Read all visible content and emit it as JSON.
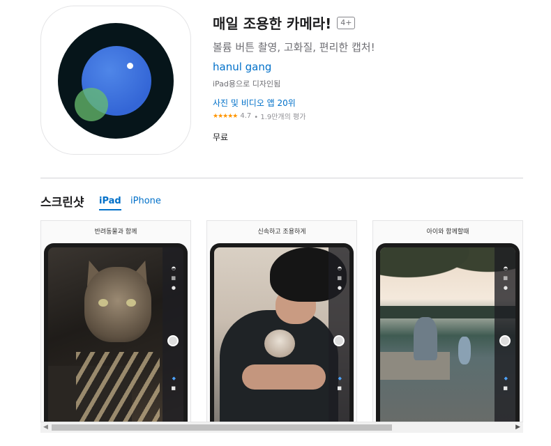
{
  "app": {
    "title": "매일 조용한 카메라!",
    "age_rating": "4+",
    "subtitle": "볼륨 버튼 촬영, 고화질, 편리한 캡처!",
    "developer": "hanul gang",
    "designed_for": "iPad용으로 디자인됨",
    "rank": "사진 및 비디오 앱 20위",
    "rating_value": "4.7",
    "rating_count": "• 1.9만개의 평가",
    "stars": "★★★★★",
    "price": "무료"
  },
  "screenshots_section": {
    "title": "스크린샷",
    "tabs": [
      "iPad",
      "iPhone"
    ],
    "captions": [
      "반려동물과 함께",
      "신속하고 조용하게",
      "아이와 함께할때"
    ]
  },
  "scrollbar": {
    "left_arrow": "◀",
    "right_arrow": "▶"
  },
  "colors": {
    "accent": "#0070c9",
    "star": "#ff9500",
    "icon_background": "#06151a",
    "lens_blue": "#3f74dd",
    "lens_green": "#68be6e"
  }
}
